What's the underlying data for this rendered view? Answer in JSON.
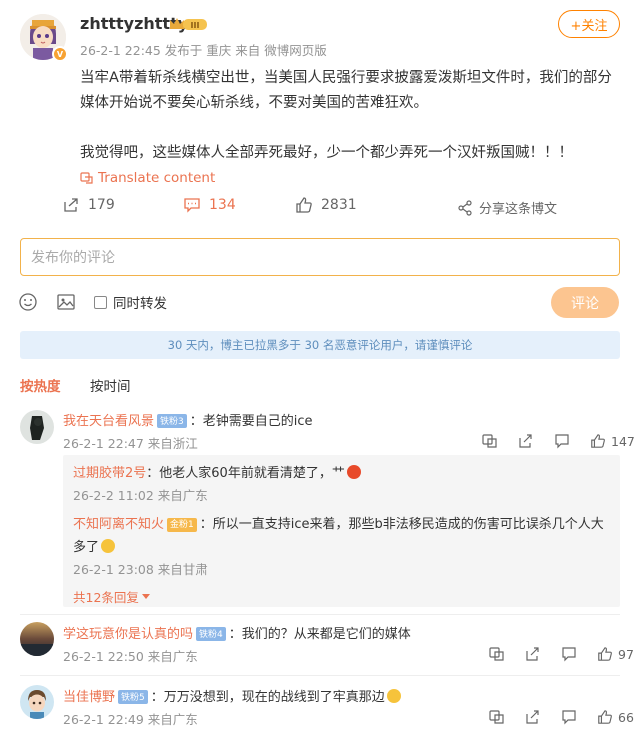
{
  "post": {
    "username": "zhtttyzhttty",
    "crown_level": "III",
    "verified_badge": "V",
    "meta": "26-2-1 22:45  发布于 重庆  来自 微博网页版",
    "follow_label": "+关注",
    "paragraph1": "当牢A带着斩杀线横空出世，当美国人民强行要求披露爱泼斯坦文件时，我们的部分媒体开始说不要矣心斩杀线，不要对美国的苦难狂欢。",
    "paragraph2": "我觉得吧，这些媒体人全部弄死最好，少一个都少弄死一个汉奸叛国贼！！！",
    "translate_label": "Translate content",
    "reposts": "179",
    "comments": "134",
    "likes": "2831",
    "share_label": "分享这条博文"
  },
  "compose": {
    "placeholder": "发布你的评论",
    "repost_label": "同时转发",
    "submit_label": "评论"
  },
  "notice": "30 天内，博主已拉黑多于 30 名恶意评论用户，请谨慎评论",
  "tabs": {
    "hot": "按热度",
    "time": "按时间"
  },
  "comments": [
    {
      "name": "我在天台看风景",
      "badge": "铁粉3",
      "text": "：老钟需要自己的ice",
      "meta": "26-2-1 22:47  来自浙江",
      "likes": "147",
      "replies": [
        {
          "name": "过期胶带2号",
          "badge": "",
          "text": "：他老人家60年前就看清楚了，",
          "emoji_text": "艹",
          "meta": "26-2-2 11:02  来自广东"
        },
        {
          "name": "不知阿离不知火",
          "badge": "金粉1",
          "text": "：所以一直支持ice来着，那些b非法移民造成的伤害可比误杀几个人大多了",
          "meta": "26-2-1 23:08  来自甘肃"
        }
      ],
      "more_replies": "共12条回复"
    },
    {
      "name": "学这玩意你是认真的吗",
      "badge": "铁粉4",
      "text": "：我们的？从来都是它们的媒体",
      "meta": "26-2-1 22:50  来自广东",
      "likes": "97"
    },
    {
      "name": "当佳博野",
      "badge": "铁粉5",
      "text": "：万万没想到，现在的战线到了牢真那边",
      "meta": "26-2-1 22:49  来自广东",
      "likes": "66"
    }
  ]
}
